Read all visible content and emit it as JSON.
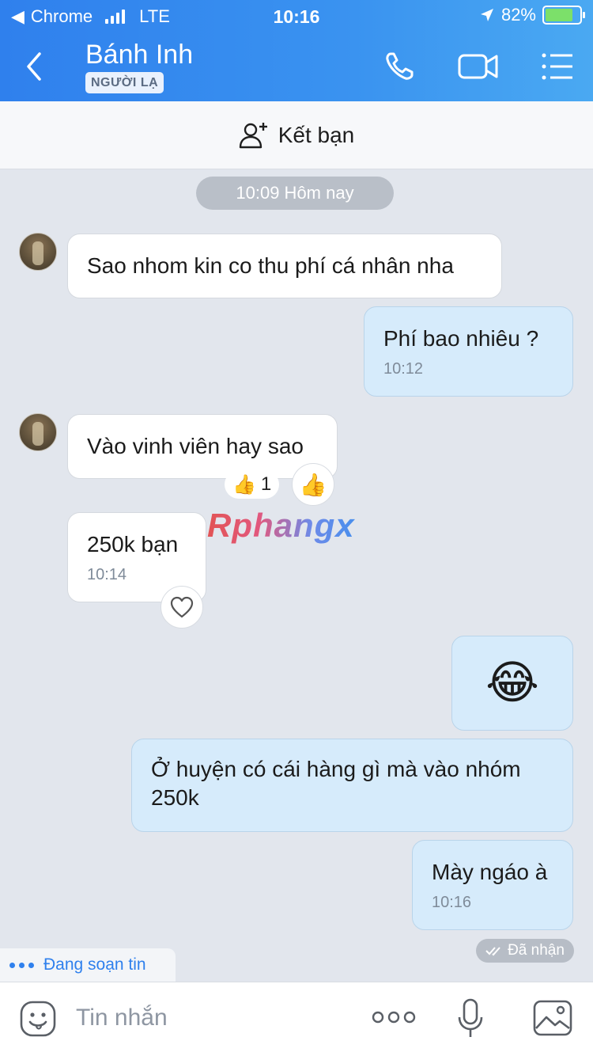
{
  "status_bar": {
    "back_app": "Chrome",
    "network": "LTE",
    "time": "10:16",
    "battery": "82%"
  },
  "header": {
    "contact_name": "Bánh Inh",
    "badge": "NGƯỜI LẠ",
    "icons": [
      "back-icon",
      "phone-icon",
      "video-icon",
      "menu-icon"
    ]
  },
  "add_friend": {
    "label": "Kết bạn"
  },
  "chat": {
    "day_stamp": "10:09 Hôm nay",
    "messages": [
      {
        "side": "in",
        "text": "Sao nhom kin co thu phí cá nhân nha"
      },
      {
        "side": "out",
        "text": "Phí bao nhiêu ?",
        "time": "10:12"
      },
      {
        "side": "in",
        "text": "Vào vinh viên hay sao"
      },
      {
        "side": "in",
        "text": "250k bạn",
        "time": "10:14"
      },
      {
        "side": "out",
        "text": "😂"
      },
      {
        "side": "out",
        "text_line1": "Ở huyện có cái hàng gì mà vào nhóm",
        "text_line2": "250k"
      },
      {
        "side": "out",
        "text": "Mày ngáo à",
        "time": "10:16"
      }
    ],
    "reaction": {
      "emoji": "👍",
      "count": "1"
    },
    "react_button": "👍",
    "watermark": "Rphangx",
    "seen": "Đã nhận",
    "typing": "Đang soạn tin"
  },
  "input_bar": {
    "placeholder": "Tin nhắn",
    "icons": [
      "emoji-icon",
      "more-icon",
      "mic-icon",
      "image-icon"
    ]
  },
  "colors": {
    "header_blue": "#2f80ed",
    "outgoing_bubble": "#d6ebfb",
    "incoming_bubble": "#ffffff",
    "chat_background": "#e2e6ed"
  }
}
